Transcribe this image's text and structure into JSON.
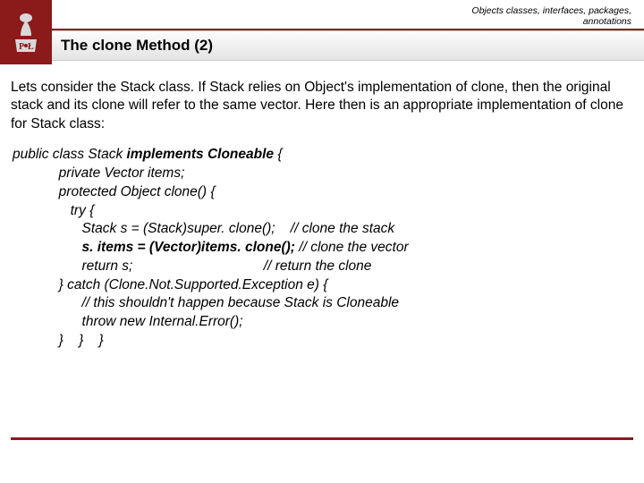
{
  "header": {
    "breadcrumb_line1": "Objects classes, interfaces, packages,",
    "breadcrumb_line2": "annotations",
    "title": "The clone Method (2)"
  },
  "intro": "Lets consider the Stack class. If Stack relies on Object's implementation of clone, then the original stack and its clone will refer to the same vector. Here then is an appropriate implementation of clone for Stack class:",
  "code": {
    "l1a": "public class Stack ",
    "l1b": "implements Cloneable ",
    "l1c": "{",
    "l2": "            private Vector items;",
    "l3": "            protected Object clone() {",
    "l4": "               try {",
    "l5": "                  Stack s = (Stack)super. clone();    // clone the stack",
    "l6a": "                  ",
    "l6b": "s. items = (Vector)items. clone(); ",
    "l6c": "// clone the vector",
    "l7": "                  return s;                                  // return the clone",
    "l8": "            } catch (Clone.Not.Supported.Exception e) {",
    "l9": "                  // this shouldn't happen because Stack is Cloneable",
    "l10": "                  throw new Internal.Error();",
    "l11": "            }    }    }"
  }
}
